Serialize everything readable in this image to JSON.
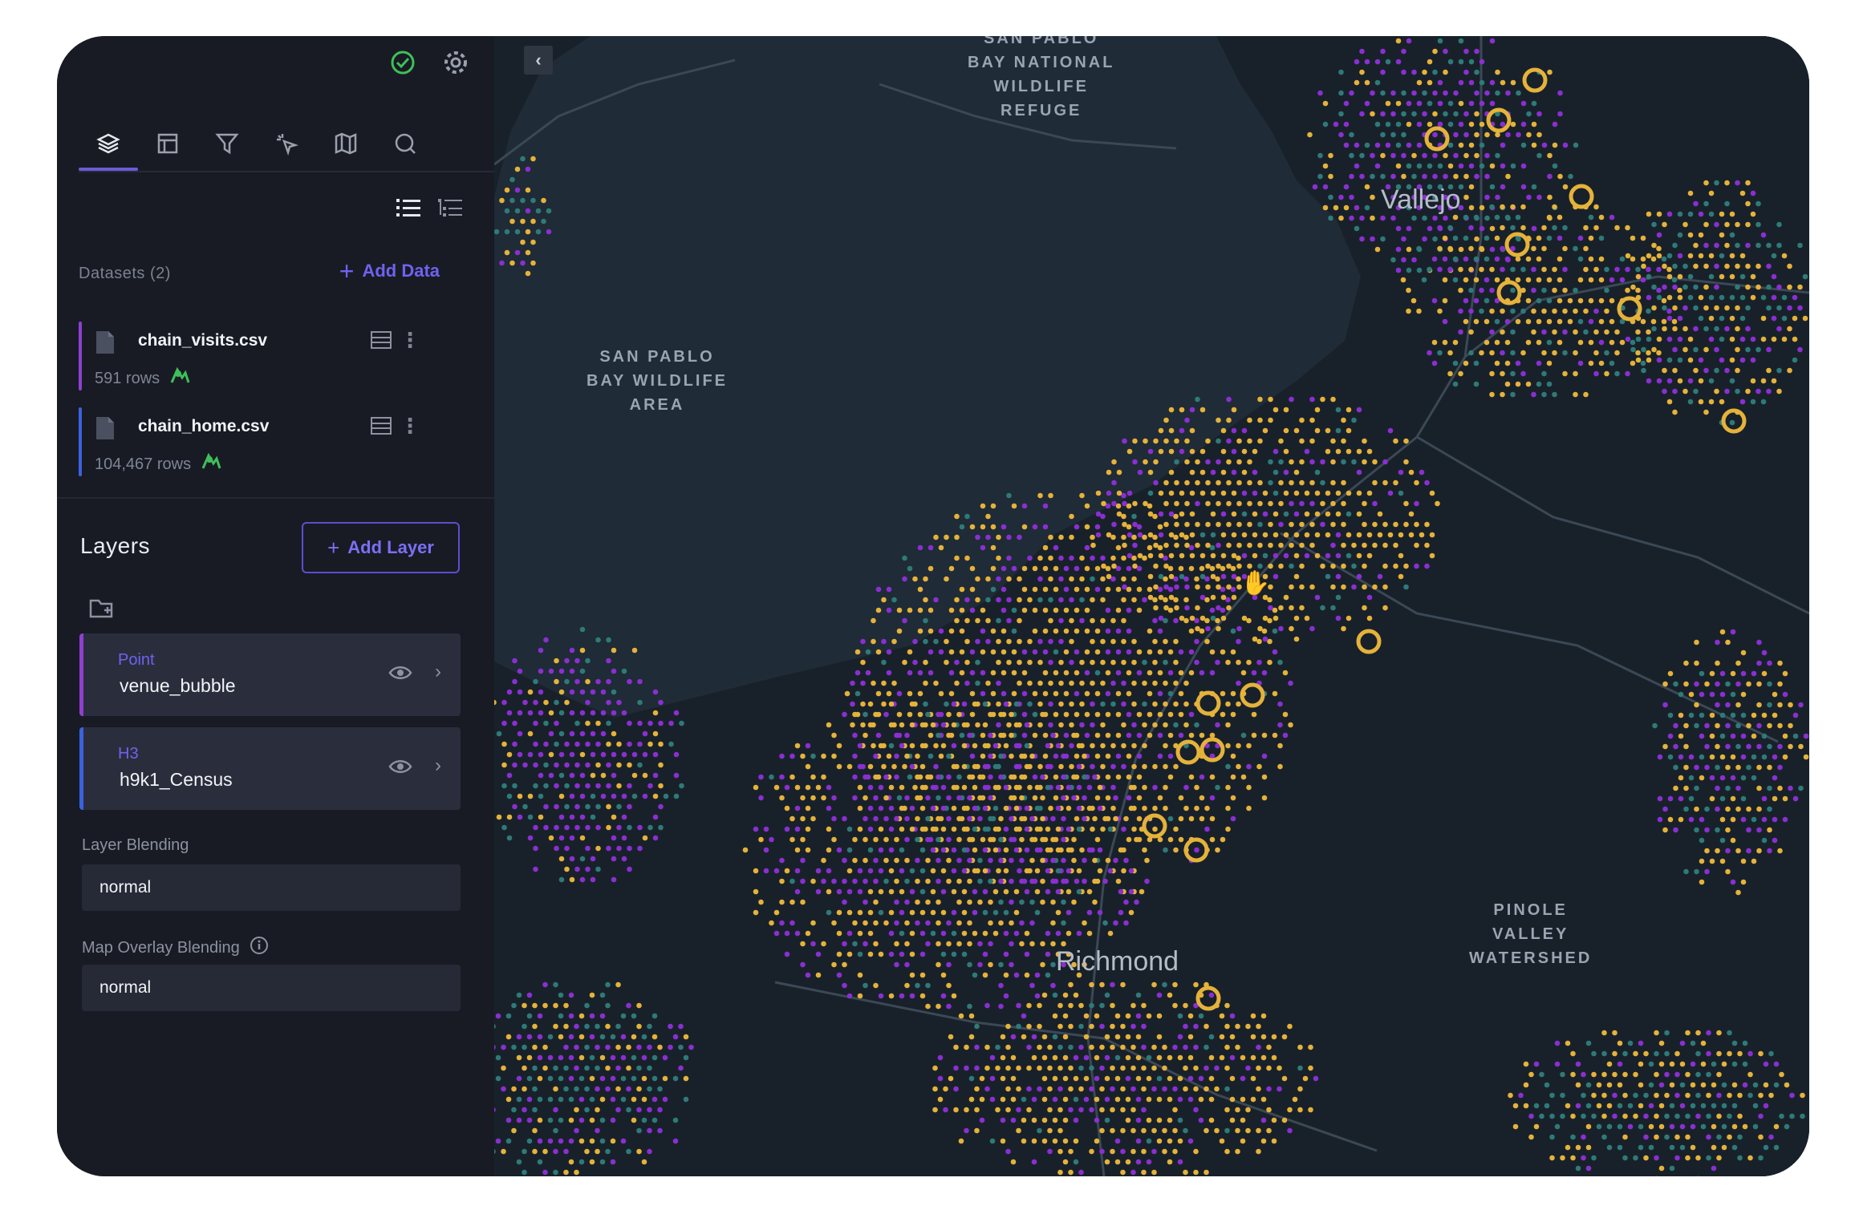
{
  "sidebar": {
    "datasets_label": "Datasets (2)",
    "add_data_label": "Add Data",
    "datasets": [
      {
        "name": "chain_visits.csv",
        "rows": "591 rows",
        "color": "#8f3fd1"
      },
      {
        "name": "chain_home.csv",
        "rows": "104,467 rows",
        "color": "#3a62e0"
      }
    ],
    "layers_title": "Layers",
    "add_layer_label": "Add Layer",
    "layers": [
      {
        "type": "Point",
        "name": "venue_bubble",
        "color": "#8f3fd1"
      },
      {
        "type": "H3",
        "name": "h9k1_Census",
        "color": "#3a62e0"
      }
    ],
    "layer_blending_label": "Layer Blending",
    "layer_blending_value": "normal",
    "overlay_blending_label": "Map Overlay Blending",
    "overlay_blending_value": "normal",
    "tabs": [
      "layers-icon",
      "interactions-icon",
      "filter-icon",
      "interaction-icon",
      "base-map-icon",
      "search-icon"
    ]
  },
  "map": {
    "labels": {
      "refuge": "SAN PABLO\nBAY NATIONAL\nWILDLIFE\nREFUGE",
      "wildlife_area": "SAN PABLO\nBAY WILDLIFE\nAREA",
      "watershed": "PINOLE\nVALLEY\nWATERSHED"
    },
    "cities": {
      "vallejo": "Vallejo",
      "richmond": "Richmond"
    },
    "colors": {
      "gold": "#e5b23a",
      "purple": "#8a2fd1",
      "teal": "#2e7a78",
      "water": "#1f2b36",
      "land": "#18212a"
    }
  }
}
